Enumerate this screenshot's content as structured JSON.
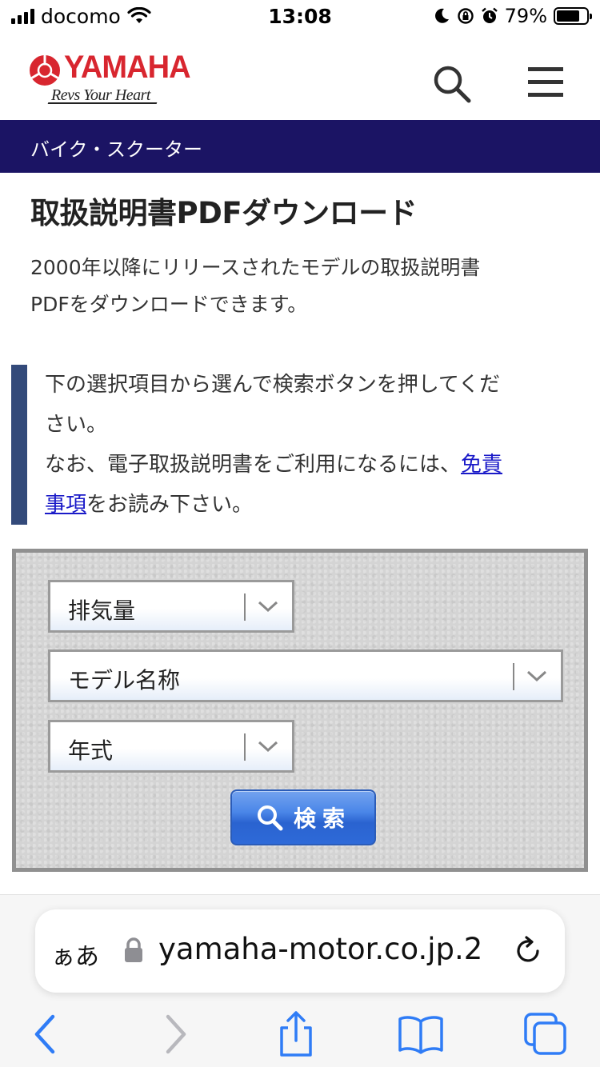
{
  "status": {
    "carrier": "docomo",
    "time": "13:08",
    "battery_percent": "79%",
    "battery_level": 0.79
  },
  "header": {
    "brand": "YAMAHA",
    "tagline": "Revs Your Heart"
  },
  "category": "バイク・スクーター",
  "page": {
    "title": "取扱説明書PDFダウンロード",
    "intro_line1": "2000年以降にリリースされたモデルの取扱説明書",
    "intro_line2": "PDFをダウンロードできます。"
  },
  "notice": {
    "line1": "下の選択項目から選んで検索ボタンを押してくだ",
    "line2": "さい。",
    "line3_before_link": "なお、電子取扱説明書をご利用になるには、",
    "link_part1": "免責",
    "link_part2": "事項",
    "line4_after_link": "をお読み下さい。"
  },
  "search_form": {
    "displacement_select": "排気量",
    "model_select": "モデル名称",
    "year_select": "年式",
    "search_button": "検索"
  },
  "browser": {
    "aa_label": "ぁあ",
    "url": "2.yamaha-motor.co.jp"
  },
  "colors": {
    "brand_red": "#d8262f",
    "category_band": "#1b1464",
    "notice_bar": "#334a7a",
    "link": "#1a1ac8",
    "safari_blue": "#2f7cf6"
  }
}
